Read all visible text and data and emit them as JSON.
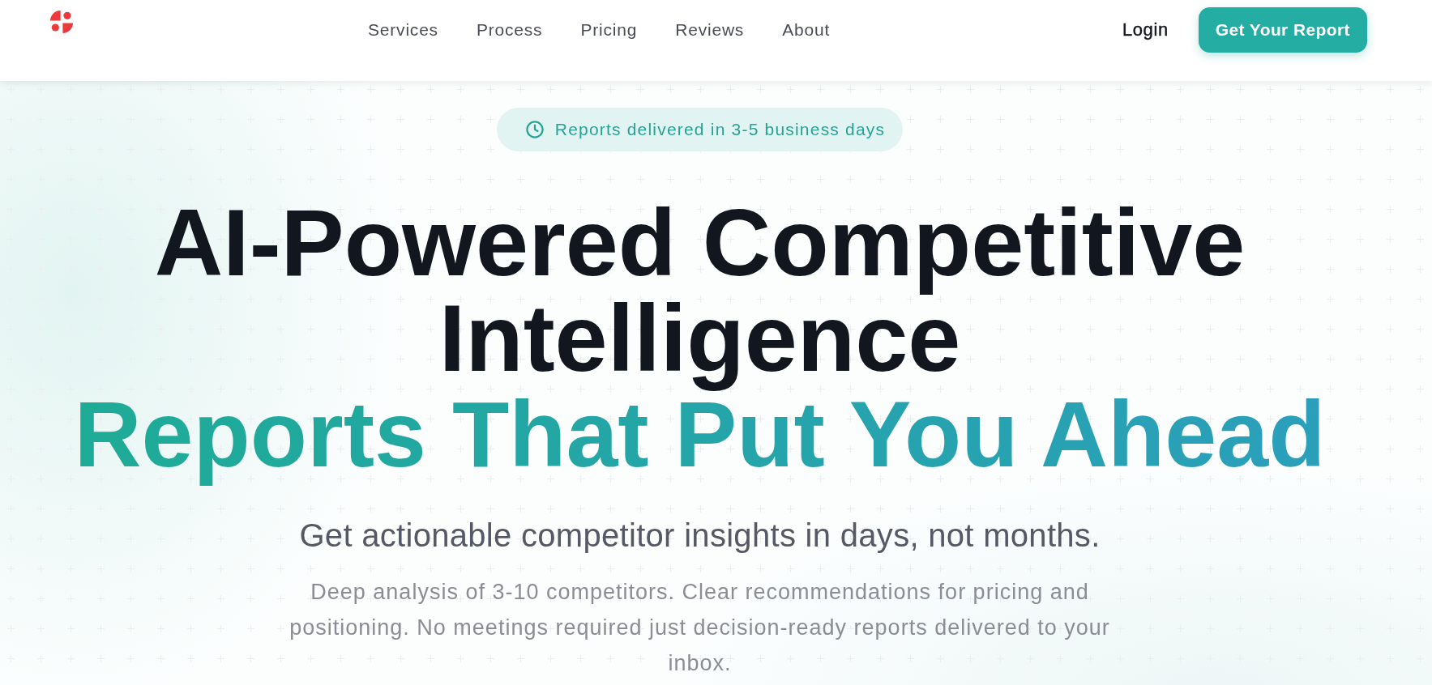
{
  "header": {
    "nav": [
      {
        "label": "Services"
      },
      {
        "label": "Process"
      },
      {
        "label": "Pricing"
      },
      {
        "label": "Reviews"
      },
      {
        "label": "About"
      }
    ],
    "login": "Login",
    "cta": "Get Your Report"
  },
  "hero": {
    "badge": "Reports delivered in 3-5 business days",
    "headline": "AI-Powered Competitive Intelligence",
    "highlight": "Reports That Put You Ahead",
    "subtitle": "Get actionable competitor insights in days, not months.",
    "description": "Deep analysis of 3-10 competitors. Clear recommendations for pricing and positioning. No meetings required just decision-ready reports delivered to your inbox."
  }
}
